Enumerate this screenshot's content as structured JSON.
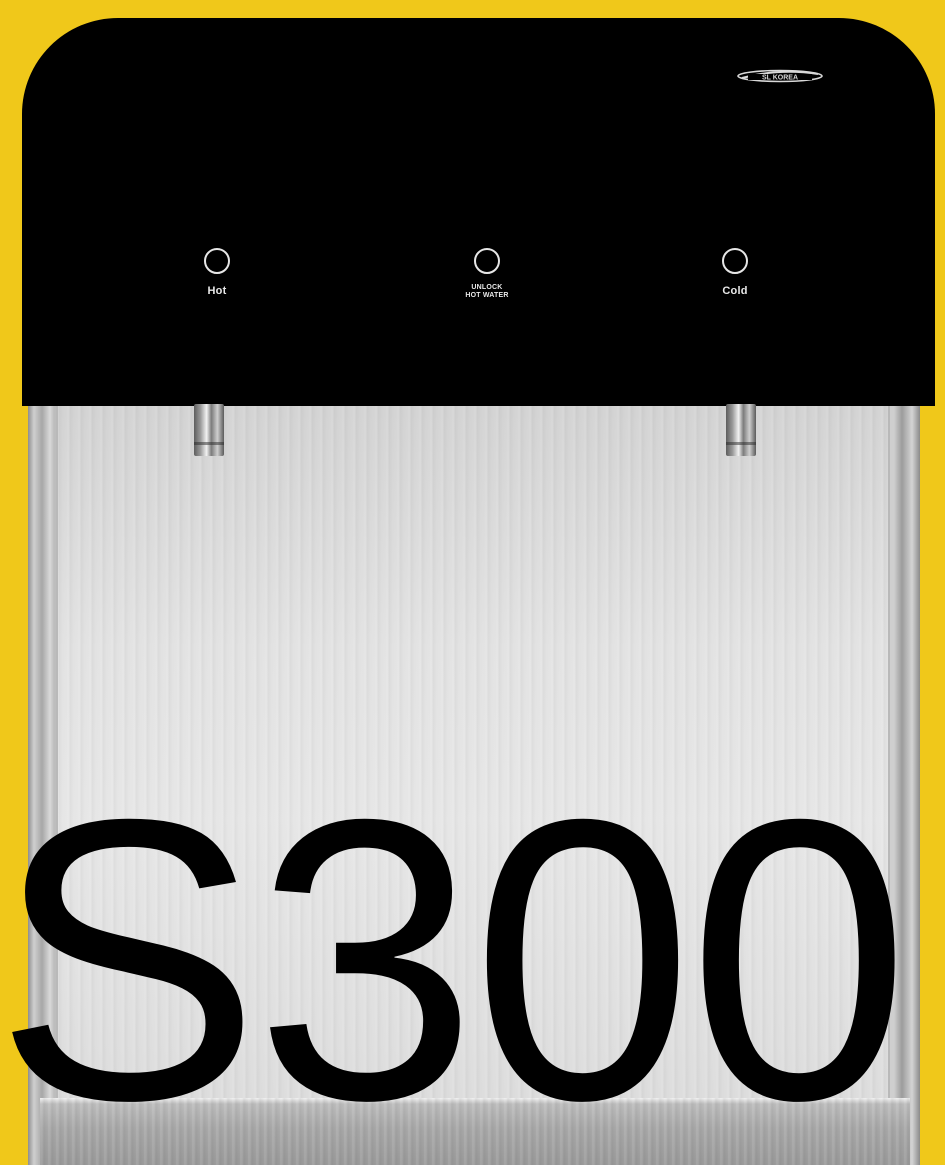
{
  "product": {
    "brand": "SL KOREA",
    "model": "S300"
  },
  "controls": {
    "hot": {
      "label": "Hot",
      "icon": "power-ring-icon"
    },
    "unlock": {
      "label_line1": "UNLOCK",
      "label_line2": "HOT WATER",
      "icon": "power-ring-icon"
    },
    "cold": {
      "label": "Cold",
      "icon": "power-ring-icon"
    }
  },
  "colors": {
    "background": "#f0c81a",
    "panel": "#000000",
    "steel": "#e0e0e0",
    "text": "#000000"
  }
}
